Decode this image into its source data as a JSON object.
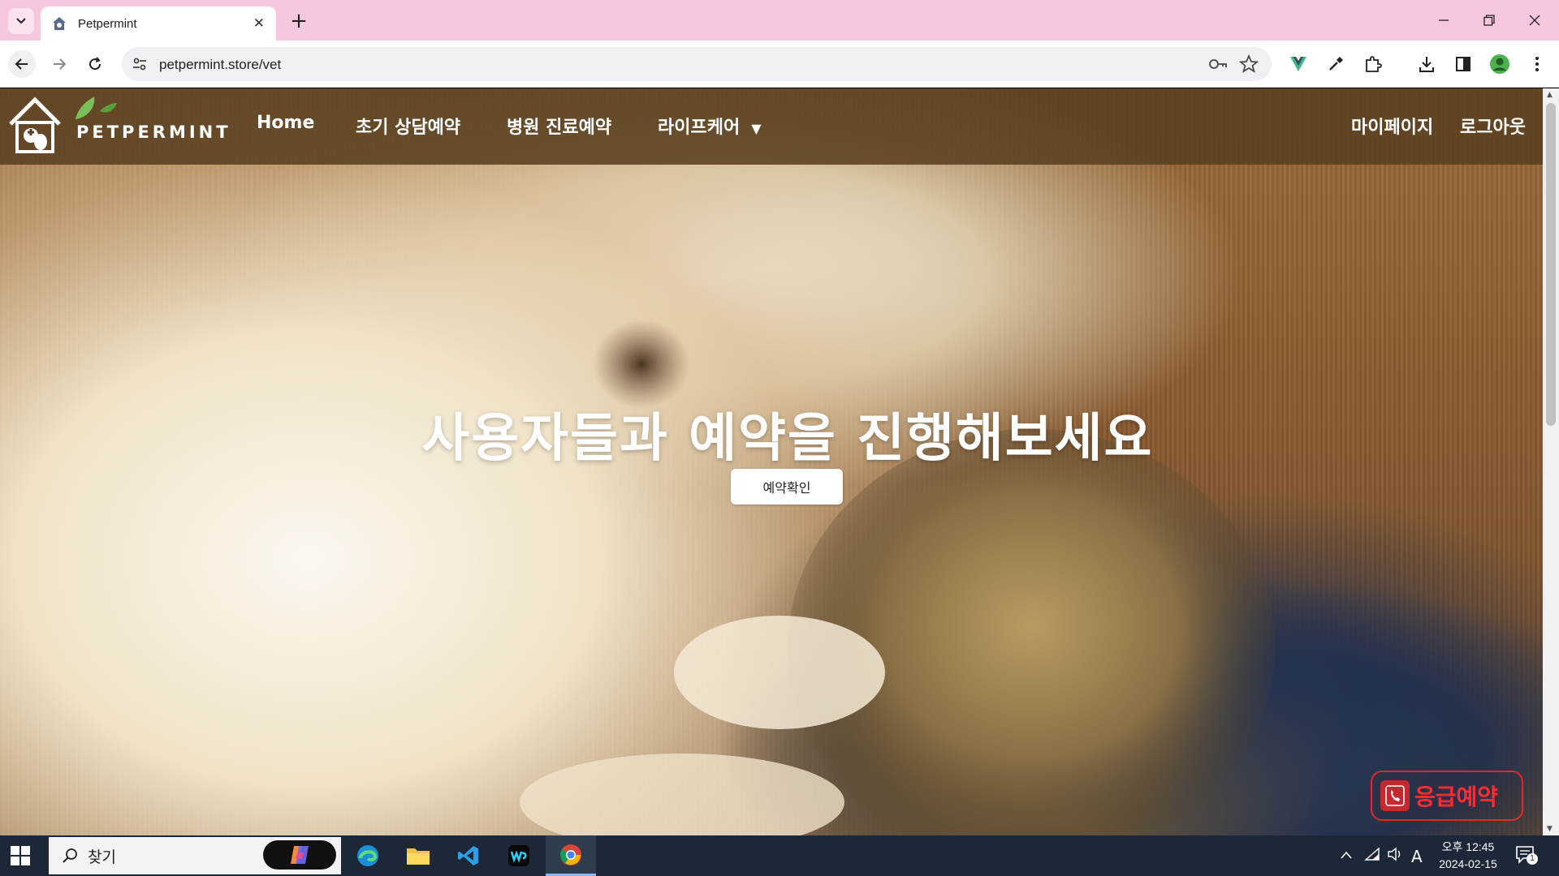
{
  "browser": {
    "tab_title": "Petpermint",
    "url": "petpermint.store/vet",
    "new_tab": "+",
    "close_tab": "✕"
  },
  "site": {
    "logo_text": "PETPERMINT",
    "nav": {
      "home": "Home",
      "consult": "초기 상담예약",
      "clinic": "병원 진료예약",
      "lifecare": "라이프케어",
      "mypage": "마이페이지",
      "logout": "로그아웃"
    },
    "hero": {
      "title": "사용자들과 예약을 진행해보세요",
      "button": "예약확인"
    },
    "emergency_label": "응급예약"
  },
  "taskbar": {
    "search_text": "찾기",
    "time": "오후 12:45",
    "date": "2024-02-15",
    "ime": "A",
    "notifications": "1"
  },
  "colors": {
    "tabbar": "#f6c7de",
    "header": "#5a4020",
    "emergency": "#e6262e",
    "taskbar": "#1c2837"
  }
}
